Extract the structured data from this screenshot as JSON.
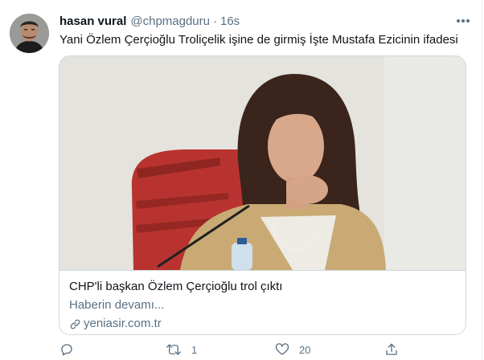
{
  "tweet": {
    "author_name": "hasan vural",
    "author_handle": "@chpmagduru",
    "separator": "·",
    "time": "16s",
    "text": "Yani Özlem Çerçioğlu Troliçelik işine de girmiş İşte Mustafa Ezicinin ifadesi"
  },
  "card": {
    "title": "CHP'li başkan Özlem Çerçioğlu trol çıktı",
    "description": "Haberin devamı...",
    "domain": "yeniasir.com.tr"
  },
  "actions": {
    "reply_count": "",
    "retweet_count": "1",
    "like_count": "20"
  },
  "icons": {
    "more": "more-dots-icon",
    "link": "link-icon",
    "reply": "reply-icon",
    "retweet": "retweet-icon",
    "like": "heart-icon",
    "share": "share-icon"
  },
  "colors": {
    "text": "#0f1419",
    "secondary": "#5b7083",
    "border": "#cfd9de"
  }
}
